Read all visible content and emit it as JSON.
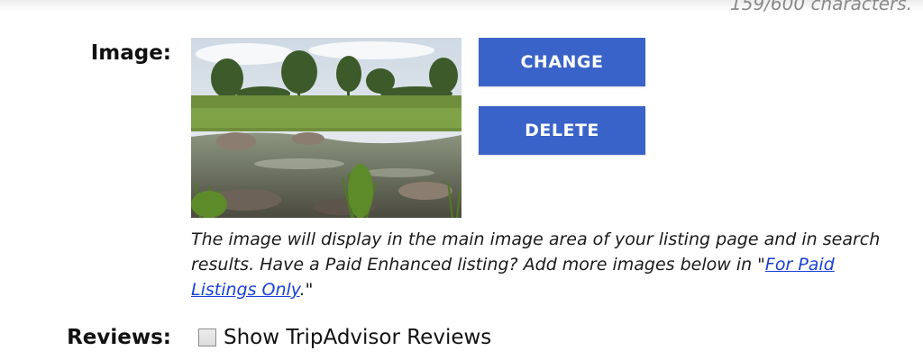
{
  "header": {
    "char_count": "159/600 characters."
  },
  "image_field": {
    "label": "Image:",
    "thumbnail_icon": "landscape-photo",
    "change_label": "CHANGE",
    "delete_label": "DELETE",
    "help_before": "The image will display in the main image area of your listing page and in search results. Have a Paid Enhanced listing? Add more images below in \"",
    "help_link": "For Paid Listings Only",
    "help_after": ".\""
  },
  "reviews_field": {
    "label": "Reviews:",
    "checkbox_label": "Show TripAdvisor Reviews",
    "checked": false
  },
  "colors": {
    "button_bg": "#3a63c9",
    "link": "#1a3fd6"
  }
}
